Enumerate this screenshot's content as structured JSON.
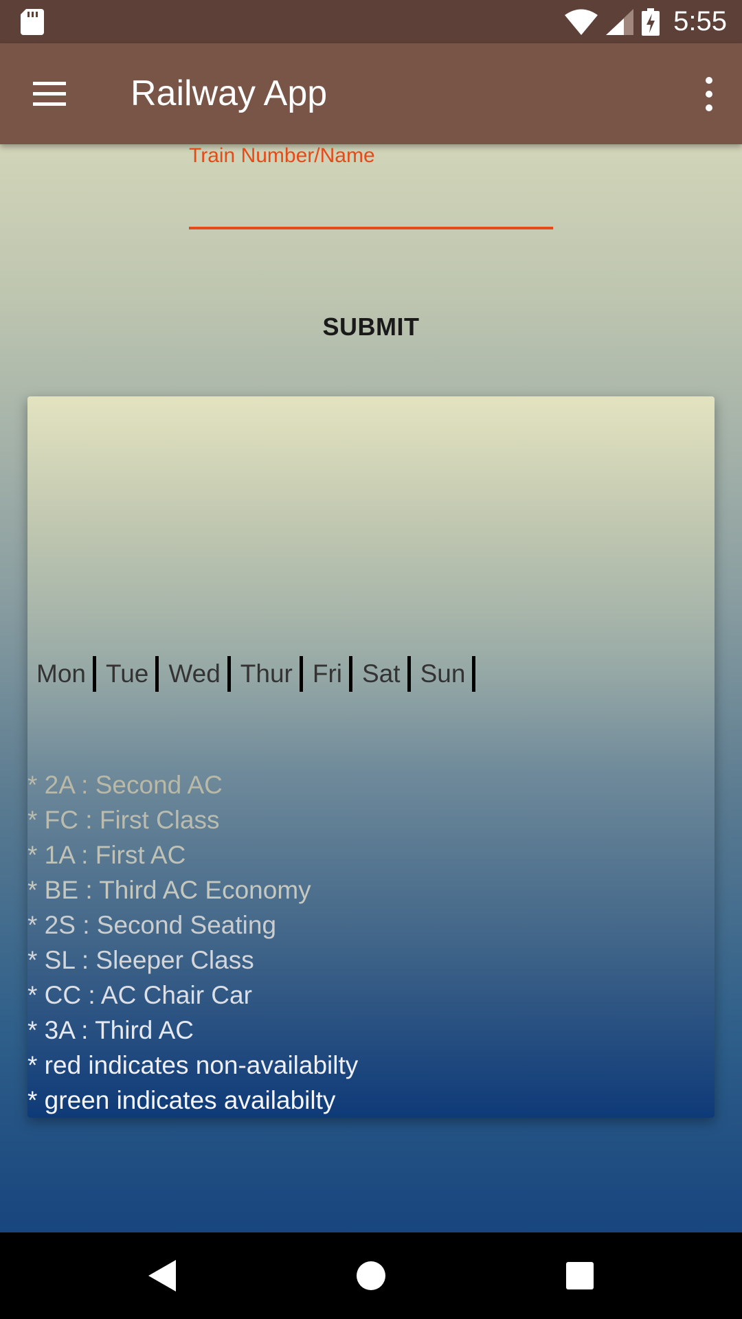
{
  "status_bar": {
    "time": "5:55",
    "icons": [
      "sd-card-icon",
      "wifi-icon",
      "signal-icon",
      "battery-charging-icon"
    ]
  },
  "app_bar": {
    "title": "Railway App",
    "menu_icon": "hamburger-menu-icon",
    "overflow_icon": "more-vert-icon"
  },
  "form": {
    "train_label": "Train Number/Name",
    "train_value": "",
    "submit_label": "SUBMIT"
  },
  "days": [
    "Mon",
    "Tue",
    "Wed",
    "Thur",
    "Fri",
    "Sat",
    "Sun"
  ],
  "legend": [
    {
      "text": "* 2A : Second AC",
      "color": "#b9b9a8"
    },
    {
      "text": "* FC : First Class",
      "color": "#b9bcae"
    },
    {
      "text": "* 1A : First AC",
      "color": "#bfc2b6"
    },
    {
      "text": "* BE : Third AC Economy",
      "color": "#c5c8bf"
    },
    {
      "text": "* 2S : Second Seating",
      "color": "#cbced0"
    },
    {
      "text": "* SL : Sleeper Class",
      "color": "#d3d6db"
    },
    {
      "text": "* CC : AC Chair Car",
      "color": "#dcdfe6"
    },
    {
      "text": "* 3A : Third AC",
      "color": "#e6e9f0"
    },
    {
      "text": "* red indicates non-availabilty",
      "color": "#eef0f6"
    },
    {
      "text": "* green indicates availabilty",
      "color": "#f4f6fb"
    }
  ],
  "colors": {
    "status_bar": "#5d4037",
    "app_bar": "#795548",
    "accent": "#e64a19"
  },
  "nav_bar": {
    "icons": [
      "back-icon",
      "home-icon",
      "recents-icon"
    ]
  }
}
